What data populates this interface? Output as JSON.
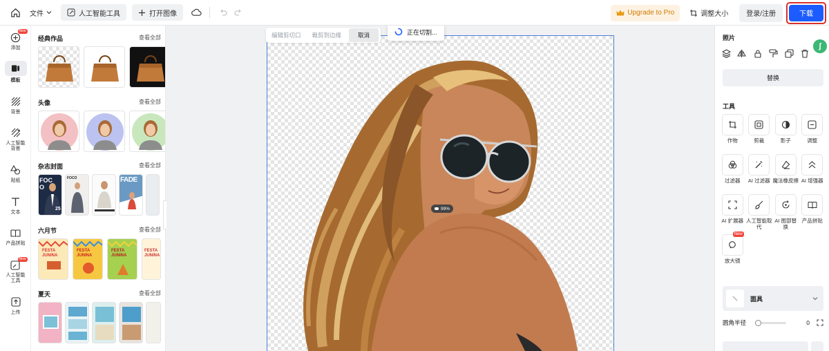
{
  "topbar": {
    "file_menu": "文件",
    "ai_tools": "人工智能工具",
    "open_image": "打开图像",
    "upgrade": "Upgrade to Pro",
    "resize": "调整大小",
    "login": "登录/注册",
    "download": "下载"
  },
  "rail": {
    "add": "添加",
    "add_badge": "New",
    "templates": "模板",
    "background": "背景",
    "ai_background": "人工智能背景",
    "stickers": "贴纸",
    "text": "文本",
    "product_collage": "产品拼贴",
    "ai_tools": "人工智能工具",
    "ai_tools_badge": "New",
    "upload": "上传"
  },
  "panel": {
    "view_all": "查看全部",
    "sections": [
      {
        "title": "经典作品"
      },
      {
        "title": "头像"
      },
      {
        "title": "杂志封面"
      },
      {
        "title": "六月节"
      },
      {
        "title": "夏天"
      }
    ],
    "magazine_texts": [
      "FOCO",
      "FOCO",
      "FADE"
    ],
    "magazine_num": "25",
    "festa_text": "FESTA JUNINA"
  },
  "canvas": {
    "toolstrip": [
      "编辑剪切口",
      "裁剪到边缘",
      "取消"
    ],
    "toast": "正在切割...",
    "zoom_pct": "99%"
  },
  "rpanel": {
    "photo_title": "照片",
    "replace": "替换",
    "tools_title": "工具",
    "tools": [
      "作物",
      "剪裁",
      "影子",
      "调整",
      "过滤器",
      "AI 过滤器",
      "魔法橡皮擦",
      "AI 增强器",
      "AI 扩展器",
      "人工智能取代",
      "AI 图部替换",
      "产品拼贴",
      "放大镜"
    ],
    "tool_badge": "New",
    "mask_label": "面具",
    "radius_label": "圆角半径",
    "radius_value": "0",
    "radius_level": 0
  },
  "colors": {
    "accent": "#1c5cff",
    "highlight_border": "#d9302c",
    "upgrade_text": "#d17a00",
    "badge": "#f0453a"
  }
}
